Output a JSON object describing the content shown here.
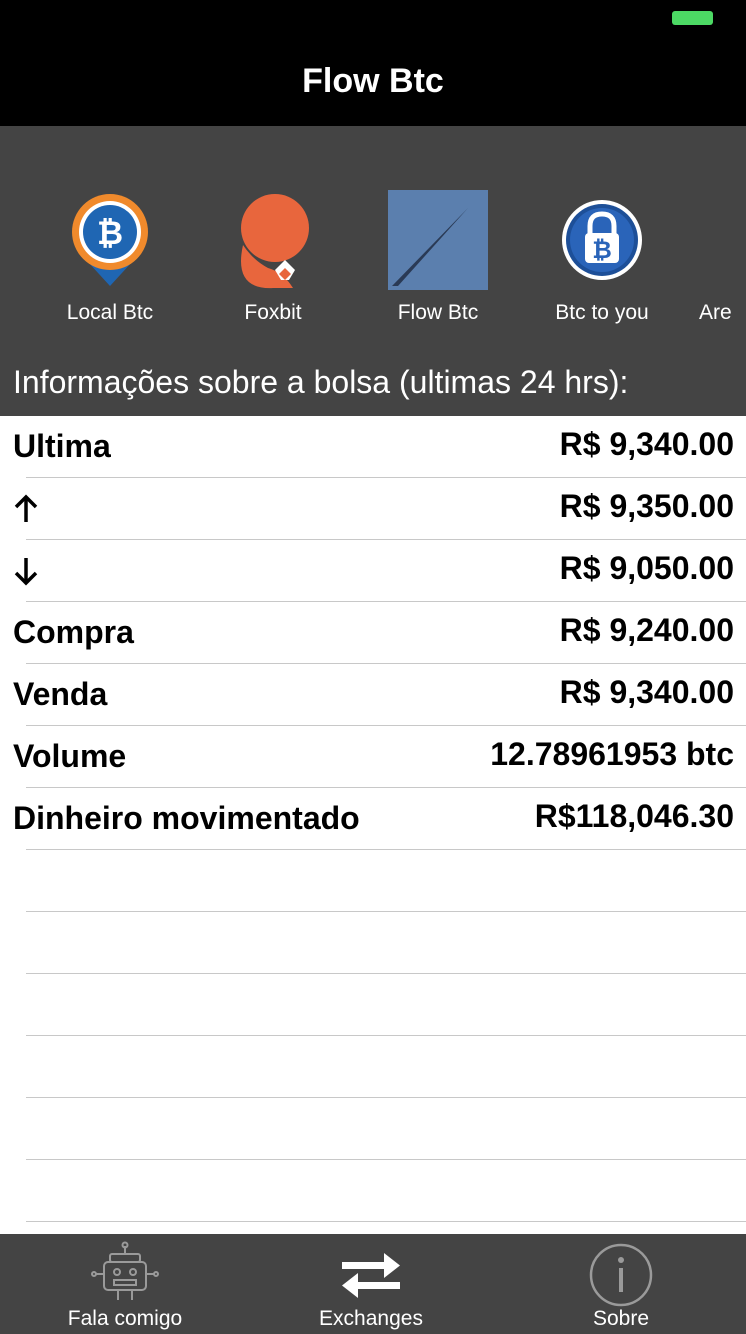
{
  "header": {
    "title": "Flow Btc"
  },
  "exchanges": [
    {
      "label": "Local Btc",
      "icon": "localbtc-logo-icon"
    },
    {
      "label": "Foxbit",
      "icon": "foxbit-logo-icon"
    },
    {
      "label": "Flow Btc",
      "icon": "flowbtc-logo-icon"
    },
    {
      "label": "Btc to you",
      "icon": "btctoyou-logo-icon"
    },
    {
      "label": "Are",
      "icon": "arena-logo-icon"
    }
  ],
  "info": {
    "title": "Informações sobre a bolsa (ultimas 24 hrs):",
    "rows": [
      {
        "label": "Ultima",
        "value": "R$ 9,340.00"
      },
      {
        "label": "",
        "icon": "arrow-up-icon",
        "value": "R$ 9,350.00"
      },
      {
        "label": "",
        "icon": "arrow-down-icon",
        "value": "R$ 9,050.00"
      },
      {
        "label": "Compra",
        "value": "R$ 9,240.00"
      },
      {
        "label": "Venda",
        "value": "R$ 9,340.00"
      },
      {
        "label": "Volume",
        "value": "12.78961953 btc"
      },
      {
        "label": "Dinheiro movimentado",
        "value": "R$118,046.30"
      }
    ]
  },
  "tabs": [
    {
      "label": "Fala comigo",
      "icon": "robot-icon"
    },
    {
      "label": "Exchanges",
      "icon": "swap-arrows-icon",
      "selected": true
    },
    {
      "label": "Sobre",
      "icon": "info-icon"
    }
  ],
  "colors": {
    "bar_background": "#000000",
    "panel_gray": "#444444",
    "status_battery": "#4cd964",
    "flowbtc_blue": "#5b7fae",
    "foxbit_orange": "#e8663d",
    "localbtc_blue": "#1f66b3",
    "localbtc_orange": "#f08a2c"
  }
}
